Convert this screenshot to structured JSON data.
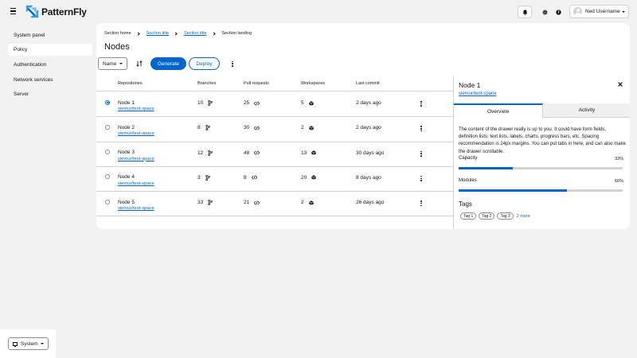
{
  "header": {
    "brand": "PatternFly",
    "user_name": "Ned Username"
  },
  "sidebar": {
    "items": [
      {
        "label": "System panel",
        "active": false
      },
      {
        "label": "Policy",
        "active": true
      },
      {
        "label": "Authentication",
        "active": false
      },
      {
        "label": "Network services",
        "active": false
      },
      {
        "label": "Server",
        "active": false
      }
    ],
    "footer_button": "System"
  },
  "breadcrumb": [
    "Section home",
    "Section title",
    "Section title",
    "Section landing"
  ],
  "page_title": "Nodes",
  "toolbar": {
    "select_label": "Name",
    "primary_label": "Generate",
    "secondary_label": "Deploy"
  },
  "table": {
    "columns": [
      "Repositories",
      "Branches",
      "Pull requests",
      "Workspaces",
      "Last commit"
    ],
    "rows": [
      {
        "name": "Node 1",
        "link": "siemur/test-space",
        "branches": "10",
        "pull_requests": "25",
        "workspaces": "5",
        "last_commit": "2 days ago",
        "selected": true
      },
      {
        "name": "Node 2",
        "link": "siemur/test-space",
        "branches": "8",
        "pull_requests": "30",
        "workspaces": "2",
        "last_commit": "2 days ago",
        "selected": false
      },
      {
        "name": "Node 3",
        "link": "siemur/test-space",
        "branches": "12",
        "pull_requests": "48",
        "workspaces": "13",
        "last_commit": "30 days ago",
        "selected": false
      },
      {
        "name": "Node 4",
        "link": "siemur/test-space",
        "branches": "3",
        "pull_requests": "8",
        "workspaces": "20",
        "last_commit": "8 days ago",
        "selected": false
      },
      {
        "name": "Node 5",
        "link": "siemur/test-space",
        "branches": "33",
        "pull_requests": "21",
        "workspaces": "2",
        "last_commit": "26 days ago",
        "selected": false
      }
    ]
  },
  "drawer": {
    "title": "Node 1",
    "link": "siemur/test-space",
    "tabs": [
      "Overview",
      "Activity"
    ],
    "description": "The content of the drawer really is up to you. It could have form fields, definition lists, text lists, labels, charts, progress bars, etc. Spacing recommendation is 24px margins. You can put tabs in here, and can also make the drawer scrollable.",
    "progress": [
      {
        "label": "Capacity",
        "value_text": "33%",
        "value": 33
      },
      {
        "label": "Modules",
        "value_text": "66%",
        "value": 66
      }
    ],
    "tags_title": "Tags",
    "tags": [
      "Tag 1",
      "Tag 2",
      "Tag 3"
    ],
    "more_label": "2 more"
  },
  "colors": {
    "accent": "#0066cc",
    "background": "#f2f2f2",
    "border": "#d2d2d2"
  }
}
